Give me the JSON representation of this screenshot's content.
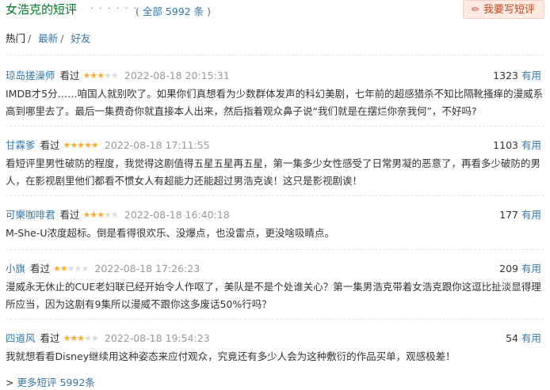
{
  "header": {
    "title": "女浩克的短评",
    "dots": "· · · · · ·",
    "all_prefix": "( ",
    "all_link": "全部 5992 条",
    "all_suffix": " )",
    "write_button": "我要写短评"
  },
  "sort": {
    "hot": "热门",
    "newest": "最新",
    "friends": "好友"
  },
  "watched_label": "看过",
  "useful_label": "有用",
  "comments": [
    {
      "user": "琼岛搓澡师",
      "stars": 3,
      "time": "2022-08-18 20:15:31",
      "votes": "1323",
      "text": "IMDB才5分……咱国人就别吹了。如果你们真想看为少数群体发声的科幻美剧，七年前的超感猎杀不知比隔靴搔痒的漫威系高到哪里去了。最后一集费奇你就直接本人出来，然后指着观众鼻子说“我们就是在摆烂你奈我何”，不好吗?"
    },
    {
      "user": "甘霖爹",
      "stars": 5,
      "time": "2022-08-18 17:11:55",
      "votes": "1103",
      "text": "看短评里男性破防的程度，我觉得这剧值得五星五星再五星，第一集多少女性感受了日常男凝的恶意了，再看多少破防的男人，在影视剧里他们都看不惯女人有超能力还能超过男浩克诶！这只是影视剧诶！"
    },
    {
      "user": "可樂咖啡君",
      "stars": 3,
      "time": "2022-08-18 16:40:18",
      "votes": "177",
      "text": "M-She-U浓度超标。倒是看得很欢乐、没爆点，也没雷点，更没啥吸睛点。"
    },
    {
      "user": "小旗",
      "stars": 2,
      "time": "2022-08-18 17:26:23",
      "votes": "209",
      "text": "漫威永无休止的CUE老妇联已经开始令人作呕了，美队是不是个处谁关心？第一集男浩克带着女浩克跟你这逗比扯淡显得理所应当，因为这剧有9集所以漫威不跟你这多废话50%行吗？"
    },
    {
      "user": "四道风",
      "stars": 3,
      "time": "2022-08-18 19:54:23",
      "votes": "54",
      "text": "我就想看看Disney继续用这种姿态来应付观众，究竟还有多少人会为这种敷衍的作品买单，观感极差！"
    }
  ],
  "more_link": "更多短评 5992条"
}
